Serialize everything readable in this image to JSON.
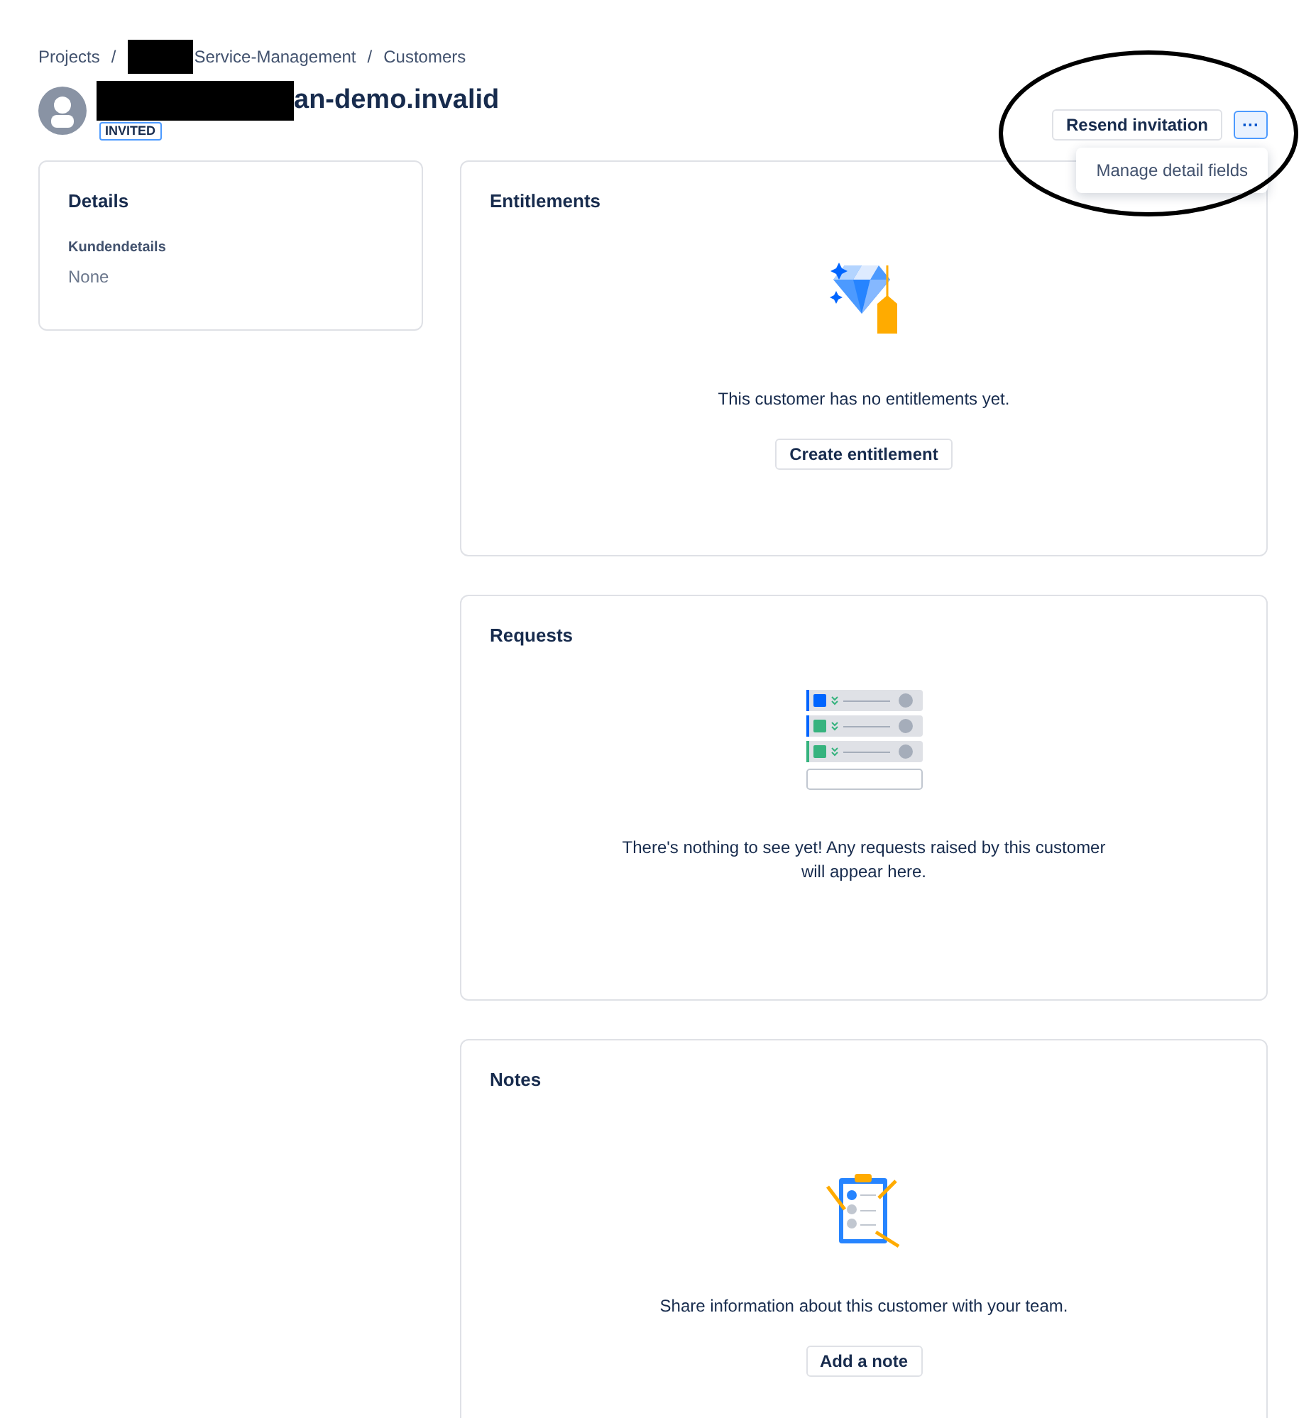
{
  "breadcrumb_separator": "/",
  "breadcrumbs": [
    {
      "label": "Projects",
      "redacted": false
    },
    {
      "label": "Service-Management",
      "redacted": true
    },
    {
      "label": "Customers",
      "redacted": false
    }
  ],
  "customer": {
    "name": "an-demo.invalid",
    "name_redacted": true,
    "status": "INVITED"
  },
  "actions": {
    "primary": "Resend invitation",
    "more": "···",
    "menu_open": true,
    "menu": [
      "Manage detail fields"
    ]
  },
  "annotation": {
    "circled": true
  },
  "details": {
    "title": "Details",
    "fields": [
      {
        "label": "Kundendetails",
        "value": "None"
      }
    ]
  },
  "sections": [
    {
      "kind": "entitlements",
      "title": "Entitlements",
      "message": "This customer has no entitlements yet.",
      "button": "Create entitlement"
    },
    {
      "kind": "requests",
      "title": "Requests",
      "message": "There's nothing to see yet! Any requests raised by this customer will appear here."
    },
    {
      "kind": "notes",
      "title": "Notes",
      "message": "Share information about this customer with your team.",
      "button": "Add a note"
    }
  ]
}
